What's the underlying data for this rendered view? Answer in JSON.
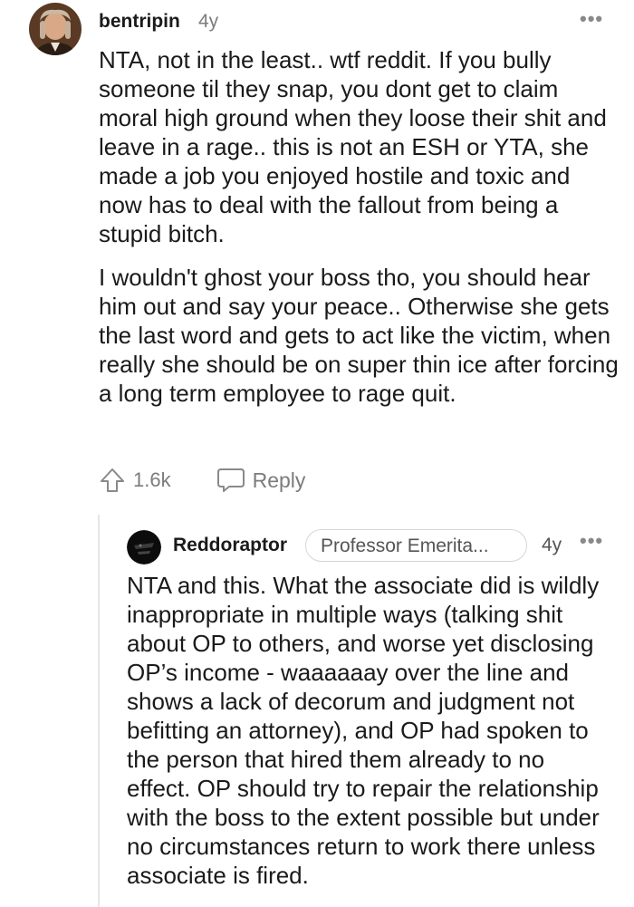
{
  "comment1": {
    "username": "bentripin",
    "age": "4y",
    "more": "•••",
    "paragraphs": [
      "NTA, not in the least.. wtf reddit. If you bully someone til they snap, you dont get to claim moral high ground when they loose their shit and leave in a rage.. this is not an ESH or YTA, she made a job you enjoyed hostile and toxic and now has to deal with the fallout from being a stupid bitch.",
      "I wouldn't ghost your boss tho, you should hear him out and say your peace.. Otherwise she gets the last word and gets to act like the victim, when really she should be on super thin ice after forcing a long term employee to rage quit."
    ],
    "votes": "1.6k",
    "reply_label": "Reply"
  },
  "comment2": {
    "username": "Reddoraptor",
    "flair": "Professor Emerita...",
    "age": "4y",
    "more": "•••",
    "paragraphs": [
      "NTA and this. What the associate did is wildly inappropriate in multiple ways (talking shit about OP to others, and worse yet disclosing OP’s income - waaaaaay over the line and shows a lack of decorum and judgment not befitting an attorney), and OP had spoken to the person that hired them already to no effect. OP should try to repair the relationship with the boss to the extent possible but under no circumstances return to work there unless associate is fired."
    ]
  },
  "icons": {
    "upvote": "upvote-arrow-icon",
    "reply": "speech-bubble-icon",
    "more": "ellipsis-icon"
  }
}
